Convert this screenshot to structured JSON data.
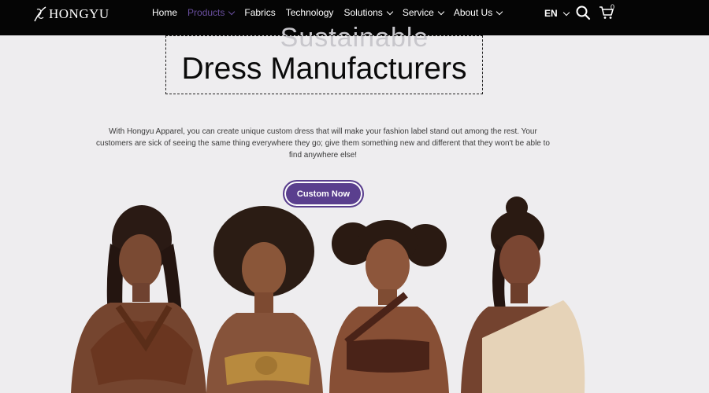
{
  "brand": {
    "logo_text": "HONGYU"
  },
  "nav": {
    "items": [
      {
        "label": "Home",
        "has_dropdown": false,
        "active": false
      },
      {
        "label": "Products",
        "has_dropdown": true,
        "active": true
      },
      {
        "label": "Fabrics",
        "has_dropdown": false,
        "active": false
      },
      {
        "label": "Technology",
        "has_dropdown": false,
        "active": false
      },
      {
        "label": "Solutions",
        "has_dropdown": true,
        "active": false
      },
      {
        "label": "Service",
        "has_dropdown": true,
        "active": false
      },
      {
        "label": "About Us",
        "has_dropdown": true,
        "active": false
      }
    ],
    "language": "EN",
    "cart_count": "0",
    "icons": {
      "search": "search-icon",
      "cart": "cart-icon"
    }
  },
  "hero": {
    "ghost_title": "Sustainable",
    "title": "Dress Manufacturers",
    "description": "With Hongyu Apparel, you can create unique custom dress that will make your fashion label stand out among the rest. Your customers are sick of seeing the same thing everywhere they go; give them something new and different that they won't be able to find anywhere else!",
    "cta_label": "Custom Now"
  },
  "colors": {
    "nav_bg": "#050505",
    "page_bg": "#eeedef",
    "accent": "#5a3f8e",
    "active_nav": "#6a4fa0"
  }
}
